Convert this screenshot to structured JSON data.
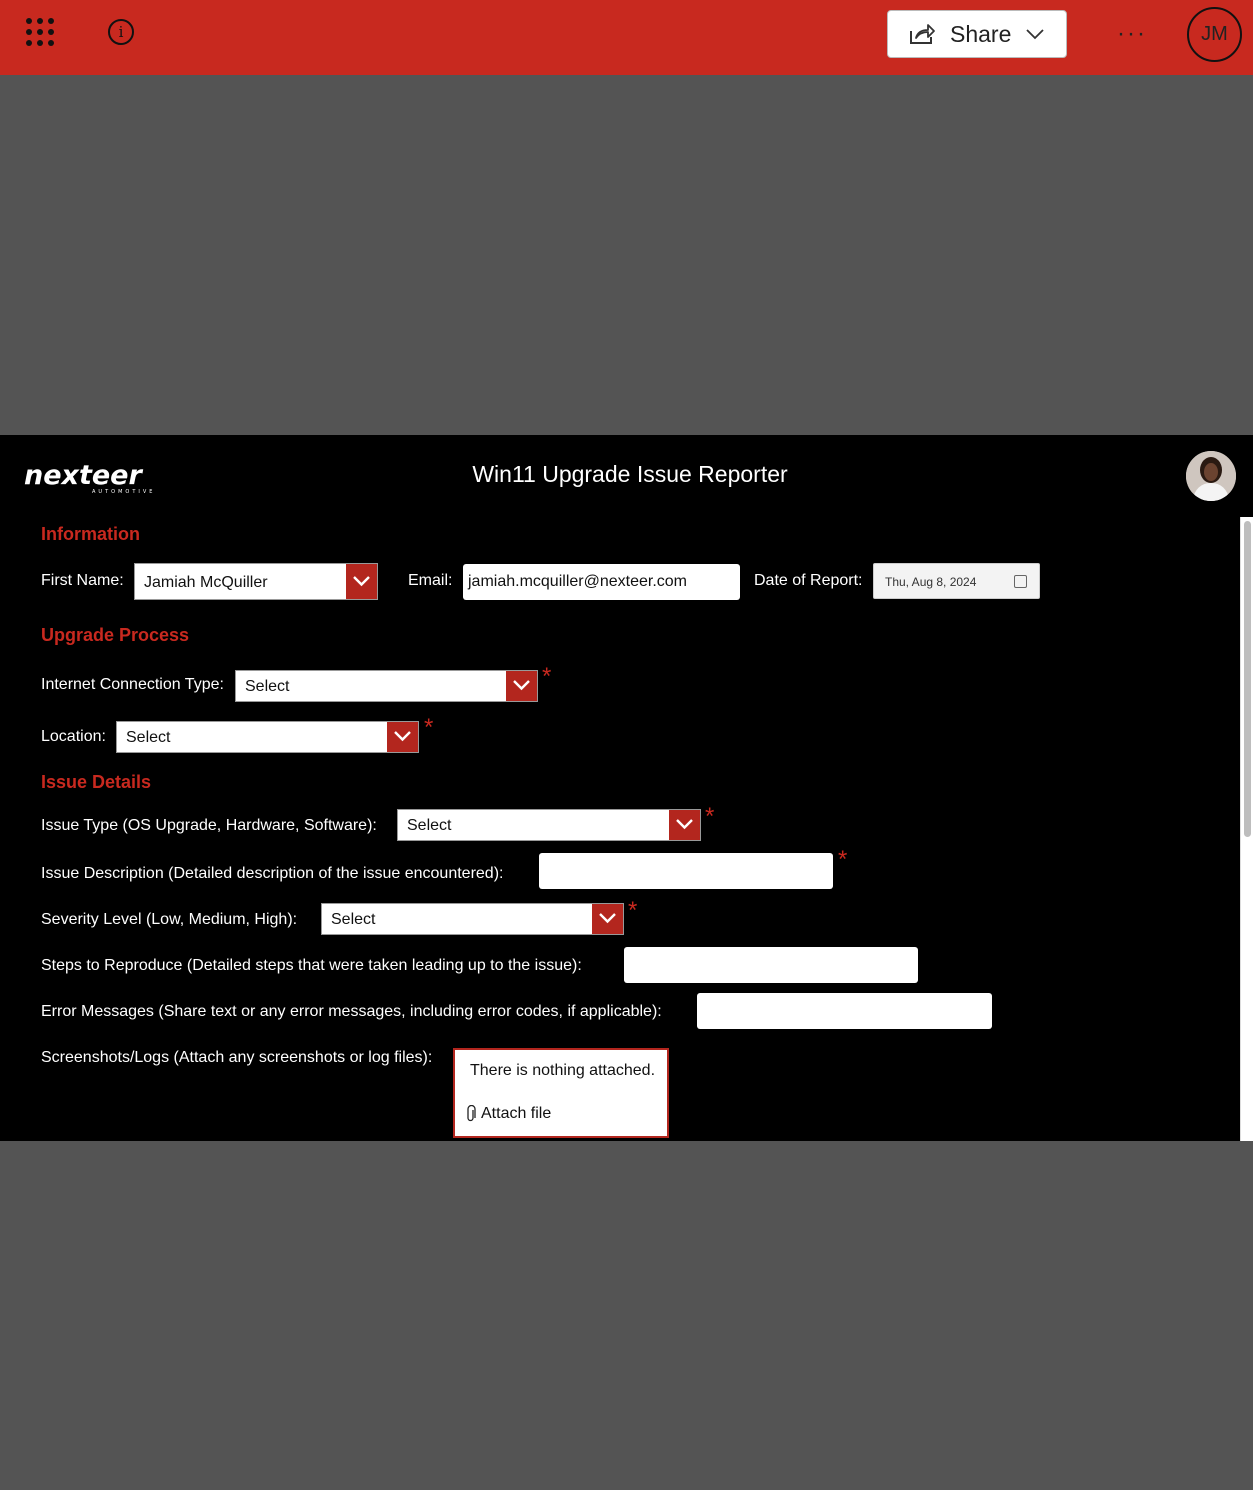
{
  "topbar": {
    "share_label": "Share",
    "more_label": "···",
    "user_initials": "JM",
    "brand_color": "#c8291f"
  },
  "app": {
    "title": "Win11 Upgrade Issue Reporter",
    "logo_text": "nexteer",
    "logo_subtext": "AUTOMOTIVE"
  },
  "information": {
    "heading": "Information",
    "first_name_label": "First Name:",
    "first_name_value": "Jamiah McQuiller",
    "email_label": "Email:",
    "email_value": "jamiah.mcquiller@nexteer.com",
    "date_label": "Date of Report:",
    "date_value": "Thu, Aug 8, 2024"
  },
  "upgrade": {
    "heading": "Upgrade Process",
    "connection_label": "Internet Connection Type:",
    "connection_value": "Select",
    "location_label": "Location:",
    "location_value": "Select"
  },
  "issue": {
    "heading": "Issue Details",
    "type_label": "Issue Type (OS Upgrade, Hardware, Software):",
    "type_value": "Select",
    "description_label": "Issue Description (Detailed description of the issue encountered):",
    "description_value": "",
    "severity_label": "Severity Level (Low, Medium, High):",
    "severity_value": "Select",
    "steps_label": "Steps to Reproduce (Detailed steps that were taken leading up to the issue):",
    "steps_value": "",
    "errors_label": "Error Messages (Share text or any error messages, including error codes, if applicable):",
    "errors_value": "",
    "attachments_label": "Screenshots/Logs (Attach any screenshots or log files):",
    "attachments_empty": "There is nothing attached.",
    "attach_button": "Attach file"
  },
  "required_marker": "*"
}
